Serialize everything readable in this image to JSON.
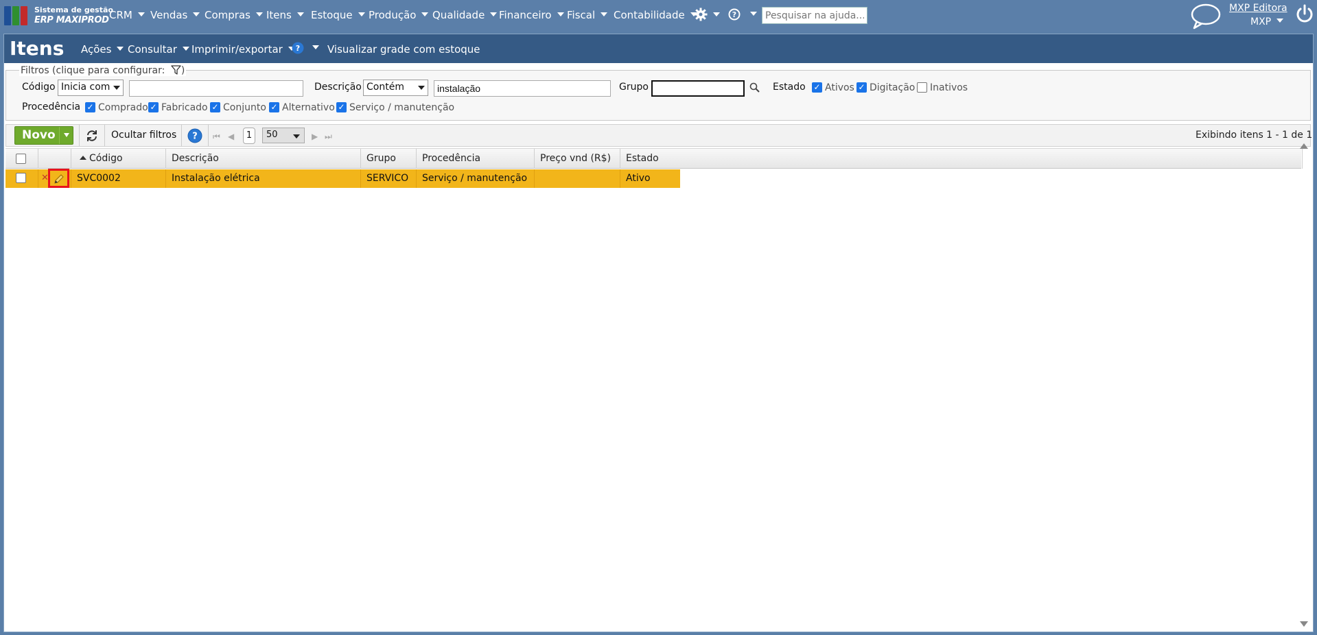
{
  "app": {
    "logo_line1": "Sistema de gestão",
    "logo_line2": "ERP MAXIPROD",
    "logo_colors": [
      "#1e4f96",
      "#2f8f2f",
      "#c22a2a"
    ]
  },
  "topnav": {
    "items": [
      {
        "label": "CRM"
      },
      {
        "label": "Vendas"
      },
      {
        "label": "Compras"
      },
      {
        "label": "Itens"
      },
      {
        "label": "Estoque"
      },
      {
        "label": "Produção"
      },
      {
        "label": "Qualidade"
      },
      {
        "label": "Financeiro"
      },
      {
        "label": "Fiscal"
      },
      {
        "label": "Contabilidade"
      }
    ],
    "search_placeholder": "Pesquisar na ajuda...",
    "user_link": "MXP Editora",
    "company": "MXP"
  },
  "page": {
    "title": "Itens",
    "actions": [
      {
        "label": "Ações"
      },
      {
        "label": "Consultar"
      },
      {
        "label": "Imprimir/exportar"
      }
    ],
    "grid_stock_link": "Visualizar grade com estoque"
  },
  "filters": {
    "legend": "Filtros (clique para configurar:",
    "legend_close": ")",
    "codigo_label": "Código",
    "codigo_mode": "Inicia com",
    "codigo_value": "",
    "descricao_label": "Descrição",
    "descricao_mode": "Contém",
    "descricao_value": "instalação",
    "grupo_label": "Grupo",
    "grupo_value": "",
    "estado_label": "Estado",
    "estado_options": [
      {
        "label": "Ativos",
        "checked": true
      },
      {
        "label": "Digitação",
        "checked": true
      },
      {
        "label": "Inativos",
        "checked": false
      }
    ],
    "procedencia_label": "Procedência",
    "procedencia_options": [
      {
        "label": "Comprado",
        "checked": true
      },
      {
        "label": "Fabricado",
        "checked": true
      },
      {
        "label": "Conjunto",
        "checked": true
      },
      {
        "label": "Alternativo",
        "checked": true
      },
      {
        "label": "Serviço / manutenção",
        "checked": true
      }
    ]
  },
  "toolbar": {
    "new_label": "Novo",
    "hide_filters_label": "Ocultar filtros",
    "page_number": "1",
    "page_size": "50",
    "status_text": "Exibindo itens 1 - 1 de 1"
  },
  "grid": {
    "columns": [
      "Código",
      "Descrição",
      "Grupo",
      "Procedência",
      "Preço vnd (R$)",
      "Estado"
    ],
    "rows": [
      {
        "codigo": "SVC0002",
        "descricao": "Instalação elétrica",
        "grupo": "SERVICO",
        "procedencia": "Serviço / manutenção",
        "preco": "",
        "estado": "Ativo"
      }
    ],
    "selected_row_color": "#f2b51a",
    "highlight_color": "#e8141b"
  }
}
